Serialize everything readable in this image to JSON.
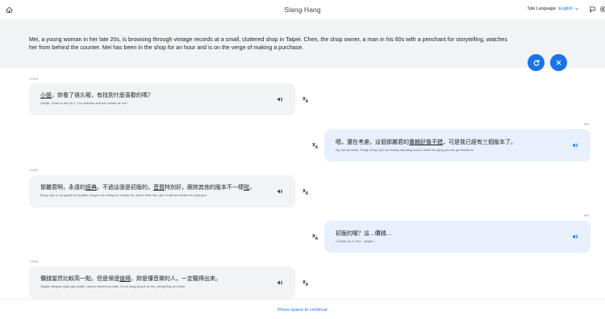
{
  "header": {
    "title": "Slang Hang",
    "site_language_label": "Site Language:",
    "site_language_value": "English",
    "icons": [
      "home-icon",
      "chevron-down-icon",
      "flag-icon",
      "settings-icon"
    ]
  },
  "scenario": {
    "text": "Mei, a young woman in her late 20s, is browsing through vintage records at a small, cluttered shop in Taipei. Chen, the shop owner, a man in his 60s with a penchant for storytelling, watches her from behind the counter. Mei has been in the shop for an hour and is on the verge of making a purchase.",
    "icons": [
      "refresh-icon",
      "close-icon"
    ]
  },
  "messages": [
    {
      "speaker": "CHEN",
      "side": "left",
      "zh": [
        [
          "小姐",
          true
        ],
        [
          "，妳看了很久喔，有找到什麼喜歡的嗎？",
          false
        ]
      ],
      "pinyin": "Xiǎojiě, nǐ kàn le hěn jiǔ o, Yǒu zhǎodào shénme xǐhuān de ma?"
    },
    {
      "speaker": "MEI",
      "side": "right",
      "zh": [
        [
          "嗯，還在考慮，這個鄧麗君的",
          false
        ],
        [
          "專輯好像不錯",
          true
        ],
        [
          "，可是我已經有三個版本了。",
          false
        ]
      ],
      "pinyin": "Ng, hái zài kǎolǜ, Zhège Dèng Lìjūn de zhuānjí hǎoxiàng búcuò, kěshì wǒ yǐjīng yǒu sān ge bǎnběn le."
    },
    {
      "speaker": "CHEN",
      "side": "left",
      "zh": [
        [
          "鄧麗君啊，永遠的",
          false
        ],
        [
          "經典",
          true
        ],
        [
          "。不過這張是初版的，",
          false
        ],
        [
          "音質",
          true
        ],
        [
          "特別好，跟妳其他的版本不一樣",
          false
        ],
        [
          "啦",
          true
        ],
        [
          "。",
          false
        ]
      ],
      "pinyin": "Dèng Lìjūn a, yǒngyuǎn de jīngdiǎn. Búguò zhè zhāng shì chūbǎn de, yīnzhì tèbié hǎo, gēn nǐ qítā de bǎnběn bù yīyàng la."
    },
    {
      "speaker": "MEI",
      "side": "right",
      "zh": [
        [
          "初版的喔？這...價錢...",
          false
        ]
      ],
      "pinyin": "Chūbǎn de o? Zhè... jiàqián..."
    },
    {
      "speaker": "CHEN",
      "side": "left",
      "zh": [
        [
          "價錢當然比較高一點，但是保證",
          false
        ],
        [
          "值得",
          true
        ],
        [
          "。妳是懂音樂的人，一定聽得出來。",
          false
        ]
      ],
      "pinyin": "Jiàqián dāngrán bǐjiào gāo yīdiǎn, dànshì bǎozhèng zhídé. Nǐ shì dǒng yīnyuè de rén, yīdìng tīng de chūlái."
    }
  ],
  "footer": {
    "continue_label": "Press space to continue"
  },
  "colors": {
    "accent": "#1a73e8",
    "bubble_left": "#f1f3f4",
    "bubble_right": "#e8f0fe",
    "scenario_bg": "#f1f3f4"
  }
}
